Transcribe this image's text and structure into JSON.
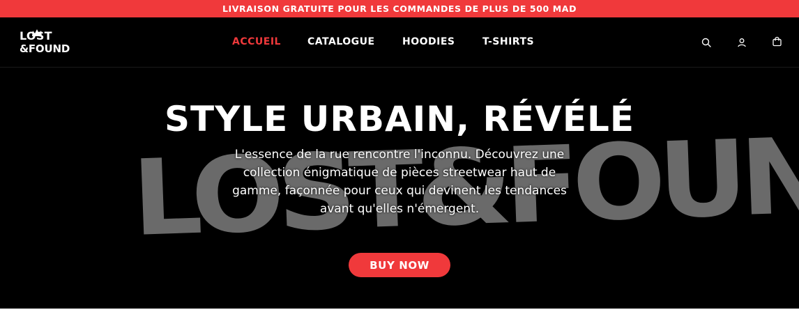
{
  "announcement": {
    "text": "LIVRAISON GRATUITE POUR LES COMMANDES DE PLUS DE 500 MAD"
  },
  "header": {
    "logo_line1": "LOST",
    "logo_line2": "&FOUND",
    "nav": [
      {
        "label": "ACCUEIL",
        "active": true
      },
      {
        "label": "CATALOGUE",
        "active": false
      },
      {
        "label": "HOODIES",
        "active": false
      },
      {
        "label": "T-SHIRTS",
        "active": false
      }
    ],
    "icons": [
      "search-icon",
      "account-icon",
      "cart-icon"
    ]
  },
  "hero": {
    "title": "STYLE URBAIN, RÉVÉLÉ",
    "background_wordmark": "LOST&FOUND",
    "description": "L'essence de la rue rencontre l'inconnu. Découvrez une collection énigmatique de pièces streetwear haut de gamme, façonnée pour ceux qui devinent les tendances avant qu'elles n'émergent.",
    "cta_label": "BUY NOW"
  },
  "colors": {
    "accent": "#f0393b",
    "background": "#000000",
    "text": "#ffffff",
    "wordmark": "#6a6a6a"
  }
}
